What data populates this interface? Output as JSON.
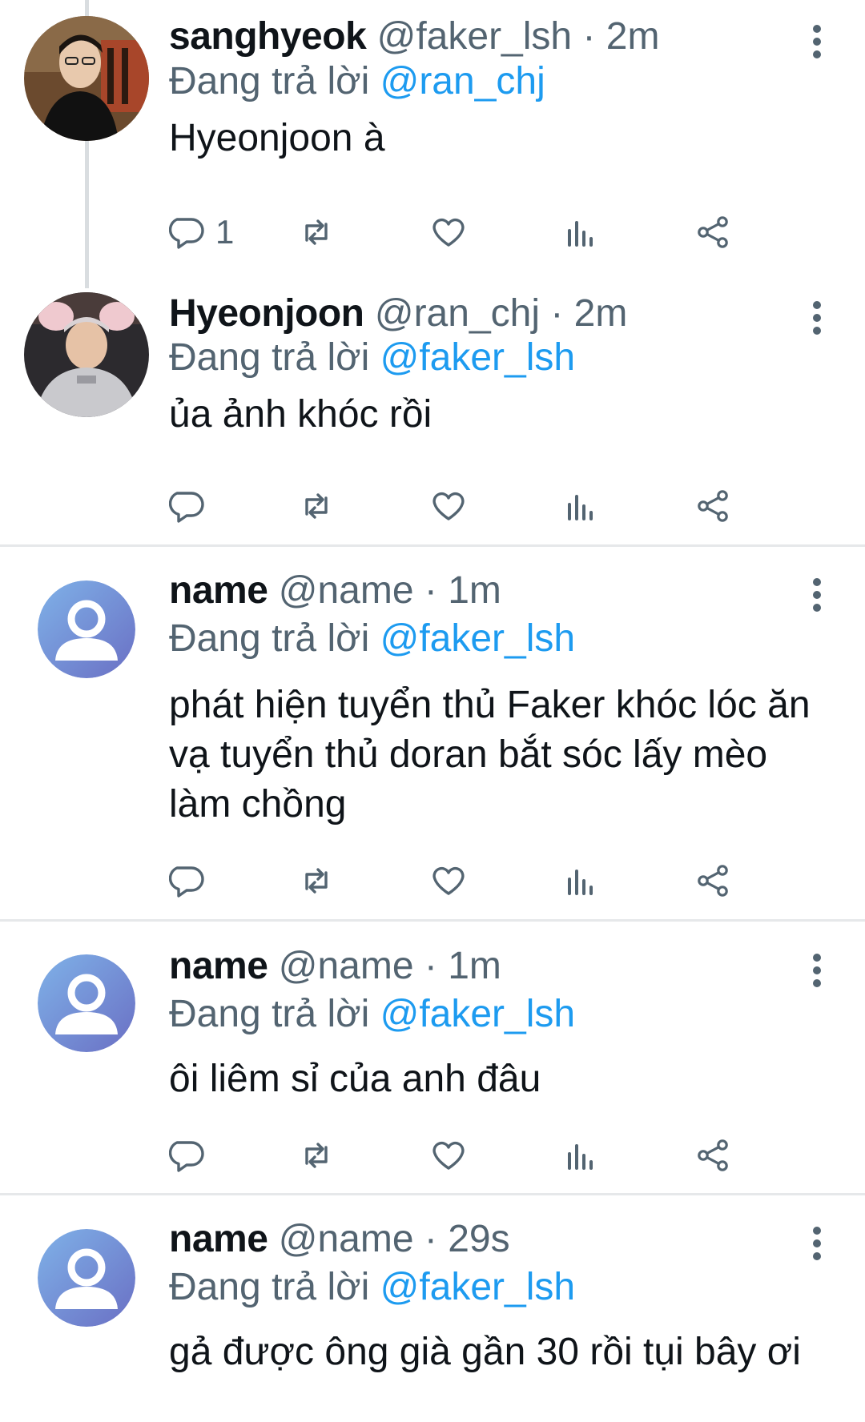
{
  "tweets": [
    {
      "name": "sanghyeok",
      "handle": "@faker_lsh",
      "time": "· 2m",
      "reply_prefix": "Đang trả lời",
      "reply_to": "@ran_chj",
      "text": "Hyeonjoon à",
      "reply_count": "1",
      "avatar": "photo-avatar-sanghyeok"
    },
    {
      "name": "Hyeonjoon",
      "handle": "@ran_chj",
      "time": "· 2m",
      "reply_prefix": "Đang trả lời",
      "reply_to": "@faker_lsh",
      "text": "ủa ảnh khóc rồi",
      "reply_count": "",
      "avatar": "photo-avatar-hyeonjoon"
    },
    {
      "name": "name",
      "handle": "@name",
      "time": "· 1m",
      "reply_prefix": "Đang trả lời",
      "reply_to": "@faker_lsh",
      "text": "phát hiện tuyển thủ Faker khóc lóc ăn vạ tuyển thủ doran bắt sóc lấy mèo làm chồng",
      "reply_count": "",
      "avatar": "default-avatar-icon"
    },
    {
      "name": "name",
      "handle": "@name",
      "time": "· 1m",
      "reply_prefix": "Đang trả lời",
      "reply_to": "@faker_lsh",
      "text": "ôi liêm sỉ của anh đâu",
      "reply_count": "",
      "avatar": "default-avatar-icon"
    },
    {
      "name": "name",
      "handle": "@name",
      "time": "· 29s",
      "reply_prefix": "Đang trả lời",
      "reply_to": "@faker_lsh",
      "text": "gả được ông già gần 30 rồi tụi bây ơi",
      "reply_count": "",
      "avatar": "default-avatar-icon"
    }
  ],
  "icons": [
    "reply-icon",
    "retweet-icon",
    "like-icon",
    "analytics-icon",
    "share-icon",
    "more-icon"
  ],
  "colors": {
    "mention": "#1d9bf0",
    "secondary": "#536471",
    "avatar_gradient_start": "#7fb2e8",
    "avatar_gradient_end": "#6a6fc4"
  }
}
